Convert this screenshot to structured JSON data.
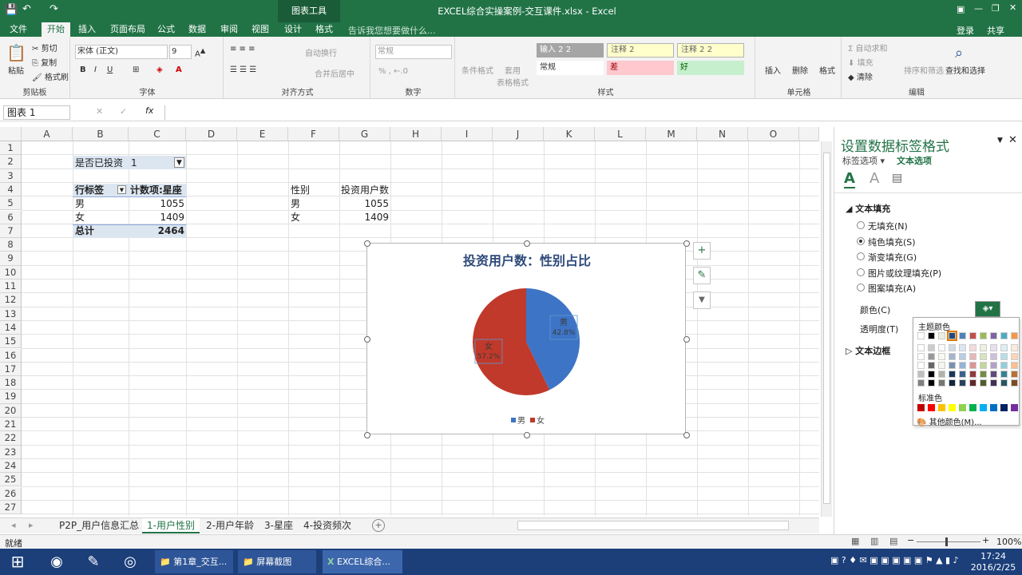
{
  "window": {
    "title": "EXCEL综合实操案例-交互课件.xlsx - Excel",
    "context_tab": "图表工具",
    "signin": "登录",
    "share": "共享"
  },
  "ribbon_tabs": [
    "文件",
    "开始",
    "插入",
    "页面布局",
    "公式",
    "数据",
    "审阅",
    "视图",
    "设计",
    "格式"
  ],
  "tell_me": "告诉我您想要做什么...",
  "clipboard": {
    "paste": "粘贴",
    "cut": "剪切",
    "copy": "复制",
    "painter": "格式刷",
    "label": "剪贴板"
  },
  "font": {
    "name": "宋体 (正文)",
    "size": "9",
    "label": "字体"
  },
  "align": {
    "wrap": "自动换行",
    "merge": "合并后居中",
    "label": "对齐方式"
  },
  "number": {
    "format": "常规",
    "label": "数字"
  },
  "styles": {
    "cond": "条件格式",
    "table": "套用\n表格格式",
    "cells": [
      "输入 2 2",
      "注释 2",
      "注释 2 2",
      "常规",
      "差",
      "好"
    ],
    "label": "样式"
  },
  "cells_grp": {
    "insert": "插入",
    "delete": "删除",
    "format": "格式",
    "label": "单元格"
  },
  "editing": {
    "autosum": "自动求和",
    "fill": "填充",
    "clear": "清除",
    "sort": "排序和筛选",
    "find": "查找和选择",
    "label": "编辑"
  },
  "formula_bar": {
    "name_box": "图表 1",
    "fx": "fx",
    "value": ""
  },
  "columns": [
    "A",
    "B",
    "C",
    "D",
    "E",
    "F",
    "G",
    "H",
    "I",
    "J",
    "K",
    "L",
    "M",
    "N",
    "O"
  ],
  "rows": [
    "1",
    "2",
    "3",
    "4",
    "5",
    "6",
    "7",
    "8",
    "9",
    "10",
    "11",
    "12",
    "13",
    "14",
    "15",
    "16",
    "17",
    "18",
    "19",
    "20",
    "21",
    "22",
    "23",
    "24",
    "25",
    "26",
    "27"
  ],
  "pivot": {
    "filter_label": "是否已投资",
    "filter_value": "1",
    "row_label": "行标签",
    "count_label": "计数项:星座",
    "rows": [
      {
        "k": "男",
        "v": "1055"
      },
      {
        "k": "女",
        "v": "1409"
      }
    ],
    "total_label": "总计",
    "total_value": "2464"
  },
  "table2": {
    "h1": "性别",
    "h2": "投资用户数",
    "rows": [
      {
        "k": "男",
        "v": "1055"
      },
      {
        "k": "女",
        "v": "1409"
      }
    ]
  },
  "chart_data": {
    "type": "pie",
    "title": "投资用户数：性别占比",
    "categories": [
      "男",
      "女"
    ],
    "values": [
      1055,
      1409
    ],
    "data_labels": [
      {
        "name": "男",
        "pct": "42.8%"
      },
      {
        "name": "女",
        "pct": "57.2%"
      }
    ],
    "colors": [
      "#3e74c5",
      "#c0392b"
    ],
    "legend": "bottom"
  },
  "chart_tools": {
    "plus": "+",
    "brush": "✎",
    "filter": "▼"
  },
  "pane": {
    "title": "设置数据标签格式",
    "tab1": "标签选项",
    "tab2": "文本选项",
    "section": "文本填充",
    "options": [
      "无填充(N)",
      "纯色填充(S)",
      "渐变填充(G)",
      "图片或纹理填充(P)",
      "图案填充(A)"
    ],
    "selected": 1,
    "color_label": "颜色(C)",
    "transparency_label": "透明度(T)",
    "border_section": "文本边框",
    "palette_title": "主题颜色",
    "standard_title": "标准色",
    "more_colors": "其他颜色(M)..."
  },
  "theme_colors": [
    "#ffffff",
    "#000000",
    "#e7e6e6",
    "#44546a",
    "#4472c4",
    "#ed7d31",
    "#a5a5a5",
    "#ffc000",
    "#5b9bd5",
    "#70ad47"
  ],
  "theme_top": [
    "#ffffff",
    "#000000",
    "#eeece1",
    "#1f497d",
    "#4f81bd",
    "#c0504d",
    "#9bbb59",
    "#8064a2",
    "#4bacc6",
    "#f79646"
  ],
  "standard_colors": [
    "#c00000",
    "#ff0000",
    "#ffc000",
    "#ffff00",
    "#92d050",
    "#00b050",
    "#00b0f0",
    "#0070c0",
    "#002060",
    "#7030a0"
  ],
  "sheets": [
    "P2P_用户信息汇总",
    "1-用户性别",
    "2-用户年龄",
    "3-星座",
    "4-投资频次"
  ],
  "active_sheet": 1,
  "status": {
    "ready": "就绪",
    "zoom": "100%"
  },
  "taskbar": {
    "items": [
      "第1章_交互...",
      "屏幕截图",
      "EXCEL综合..."
    ],
    "time": "17:24",
    "date": "2016/2/25"
  }
}
